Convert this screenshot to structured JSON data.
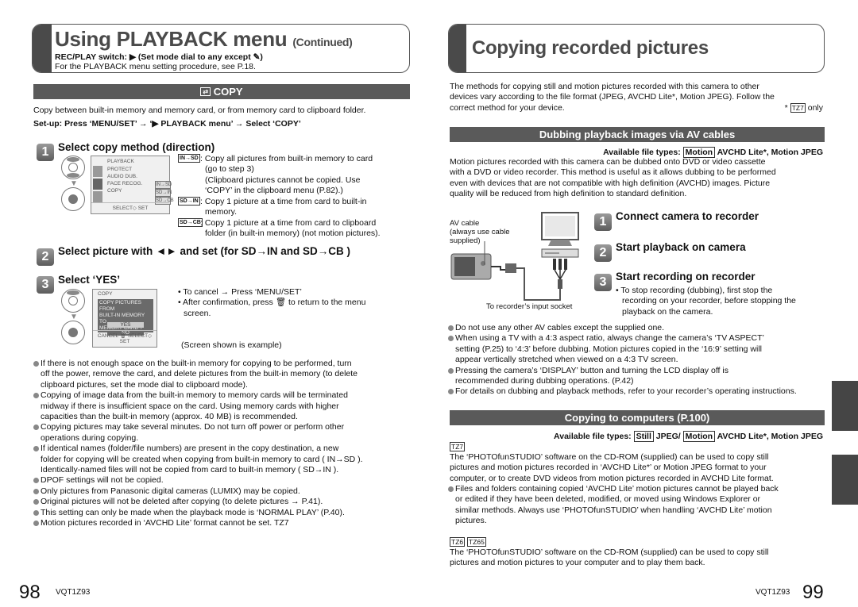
{
  "left_page": {
    "title": "Using PLAYBACK menu",
    "title_suffix": "(Continued)",
    "switch_line": "REC/PLAY switch: ▶ (Set mode dial to any except ✎)",
    "procedure_note": "For the PLAYBACK menu setting procedure, see P.18.",
    "section": {
      "icon": "copy-icon",
      "label": "COPY"
    },
    "intro": "Copy between built-in memory and memory card, or from memory card to clipboard folder.",
    "setup": "Set-up: Press ‘MENU/SET’ → ‘▶ PLAYBACK menu’ → Select ‘COPY’",
    "steps": [
      {
        "number": "1",
        "title": "Select copy method (direction)",
        "screen": {
          "header": "PLAYBACK",
          "rows": [
            "PROTECT",
            "AUDIO DUB.",
            "FACE RECOG.",
            "COPY"
          ],
          "options": [
            "IN→SD",
            "SD→IN",
            "SD→CB"
          ],
          "footer": "SELECT◇ SET"
        },
        "options": [
          {
            "icon": "IN→SD",
            "text": "Copy all pictures from built-in memory to card (go to step 3) (Clipboard pictures cannot be copied. Use ‘COPY’ in the clipboard menu (P.82).)"
          },
          {
            "icon": "SD→IN",
            "text": "Copy 1 picture at a time from card to built-in memory."
          },
          {
            "icon": "SD→CB",
            "text": "Copy 1 picture at a time from card to clipboard folder (in built-in memory) (not motion pictures)."
          }
        ],
        "option_lines": [
          [
            "Copy all pictures from built-in memory to card",
            "(go to step 3)",
            "(Clipboard pictures cannot be copied. Use",
            "‘COPY’ in the clipboard menu (P.82).)"
          ],
          [
            "Copy 1 picture at a time from card to built-in",
            "memory."
          ],
          [
            "Copy 1 picture at a time from card to clipboard",
            "folder (in built-in memory) (not motion pictures)."
          ]
        ]
      },
      {
        "number": "2",
        "title": "Select picture with ◄► and set (for SD→IN and SD→CB )"
      },
      {
        "number": "3",
        "title": "Select ‘YES’",
        "screen": {
          "header": "COPY",
          "message": [
            "COPY PICTURES FROM",
            "BUILT-IN MEMORY TO",
            "MEMORY CARD ?"
          ],
          "yes": "YES",
          "no": "NO",
          "footer": "CANCEL 🗑 SELECT◇ SET"
        },
        "notes": [
          "To cancel → Press ‘MENU/SET’",
          "After confirmation, press 🗑 to return to the menu",
          "screen."
        ],
        "caption": "(Screen shown is example)"
      }
    ],
    "bullets": [
      [
        "If there is not enough space on the built-in memory for copying to be performed, turn",
        "off the power, remove the card, and delete pictures from the built-in memory (to delete",
        "clipboard pictures, set the mode dial to clipboard mode)."
      ],
      [
        "Copying of image data from the built-in memory to memory cards will be terminated",
        "midway if there is insufficient space on the card. Using memory cards with higher",
        "capacities than the built-in memory (approx. 40 MB) is recommended."
      ],
      [
        "Copying pictures may take several minutes. Do not turn off power or perform other",
        "operations during copying."
      ],
      [
        "If identical names (folder/file numbers) are present in the copy destination, a new",
        "folder for copying will be created when copying from built-in memory to card ( IN→SD ).",
        "Identically-named files will not be copied from card to built-in memory ( SD→IN )."
      ],
      [
        "DPOF settings will not be copied."
      ],
      [
        "Only pictures from Panasonic digital cameras (LUMIX) may be copied."
      ],
      [
        "Original pictures will not be deleted after copying (to delete pictures → P.41)."
      ],
      [
        "This setting can only be made when the playback mode is ‘NORMAL PLAY’ (P.40)."
      ],
      [
        "Motion pictures recorded in ‘AVCHD Lite’ format cannot be set. TZ7"
      ]
    ],
    "page_number": "98",
    "doc_code": "VQT1Z93"
  },
  "right_page": {
    "title": "Copying recorded pictures",
    "intro_lines": [
      "The methods for copying still and motion pictures recorded with this camera to other",
      "devices vary according to the file format (JPEG, AVCHD Lite*, Motion JPEG). Follow the",
      "correct method for your device."
    ],
    "footnote": "* TZ7 only",
    "dubbing": {
      "heading": "Dubbing playback images via AV cables",
      "file_types_label": "Available file types:",
      "file_types_box": "Motion",
      "file_types_rest": "AVCHD Lite*, Motion JPEG",
      "body_lines": [
        "Motion pictures recorded with this camera can be dubbed onto DVD or video cassette",
        "with a DVD or video recorder. This method is useful as it allows dubbing to be performed",
        "even with devices that are not compatible with high definition (AVCHD) images. Picture",
        "quality will be reduced from high definition to standard definition."
      ],
      "diagram": {
        "cable_label": [
          "AV cable",
          "(always use cable",
          "supplied)"
        ],
        "socket_label": "To recorder’s input socket"
      },
      "steps": [
        {
          "number": "1",
          "title": "Connect camera to recorder"
        },
        {
          "number": "2",
          "title": "Start playback on camera"
        },
        {
          "number": "3",
          "title": "Start recording on recorder",
          "note_lines": [
            "• To stop recording (dubbing), first stop the",
            "recording on your recorder, before stopping the",
            "playback on the camera."
          ]
        }
      ],
      "bullets": [
        [
          "Do not use any other AV cables except the supplied one."
        ],
        [
          "When using a TV with a 4:3 aspect ratio, always change the camera’s ‘TV ASPECT’",
          "setting (P.25) to ‘4:3’ before dubbing. Motion pictures copied in the ‘16:9’ setting will",
          "appear vertically stretched when viewed on a 4:3 TV screen."
        ],
        [
          "Pressing the camera’s ‘DISPLAY’ button and turning the LCD display off is",
          "recommended during dubbing operations. (P.42)"
        ],
        [
          "For details on dubbing and playback methods, refer to your recorder’s operating instructions."
        ]
      ]
    },
    "computers": {
      "heading": "Copying to computers (P.100)",
      "file_types_label": "Available file types:",
      "still_box": "Still",
      "still_rest": "JPEG/",
      "motion_box": "Motion",
      "motion_rest": "AVCHD Lite*, Motion JPEG",
      "model_tag_1": "TZ7",
      "body_lines": [
        "The ‘PHOTOfunSTUDIO’ software on the CD-ROM (supplied) can be used to copy still",
        "pictures and motion pictures recorded in ‘AVCHD Lite*’ or Motion JPEG format to your",
        "computer, or to create DVD videos from motion pictures recorded in AVCHD Lite format."
      ],
      "bullet_lines": [
        "Files and folders containing copied ‘AVCHD Lite’ motion pictures cannot be played back",
        "or edited if they have been deleted, modified, or moved using Windows Explorer or",
        "similar methods. Always use ‘PHOTOfunSTUDIO’ when handling ‘AVCHD Lite’ motion",
        "pictures."
      ],
      "model_tags_2": [
        "TZ6",
        "TZ65"
      ],
      "body2_lines": [
        "The ‘PHOTOfunSTUDIO’ software on the CD-ROM (supplied) can be used to copy still",
        "pictures and motion pictures to your computer and to play them back."
      ]
    },
    "page_number": "99",
    "doc_code": "VQT1Z93"
  },
  "colors": {
    "title_gray": "#4a4a4a",
    "section_bar": "#5a5a5a",
    "side_tab": "#454545",
    "bullet": "#888888"
  }
}
